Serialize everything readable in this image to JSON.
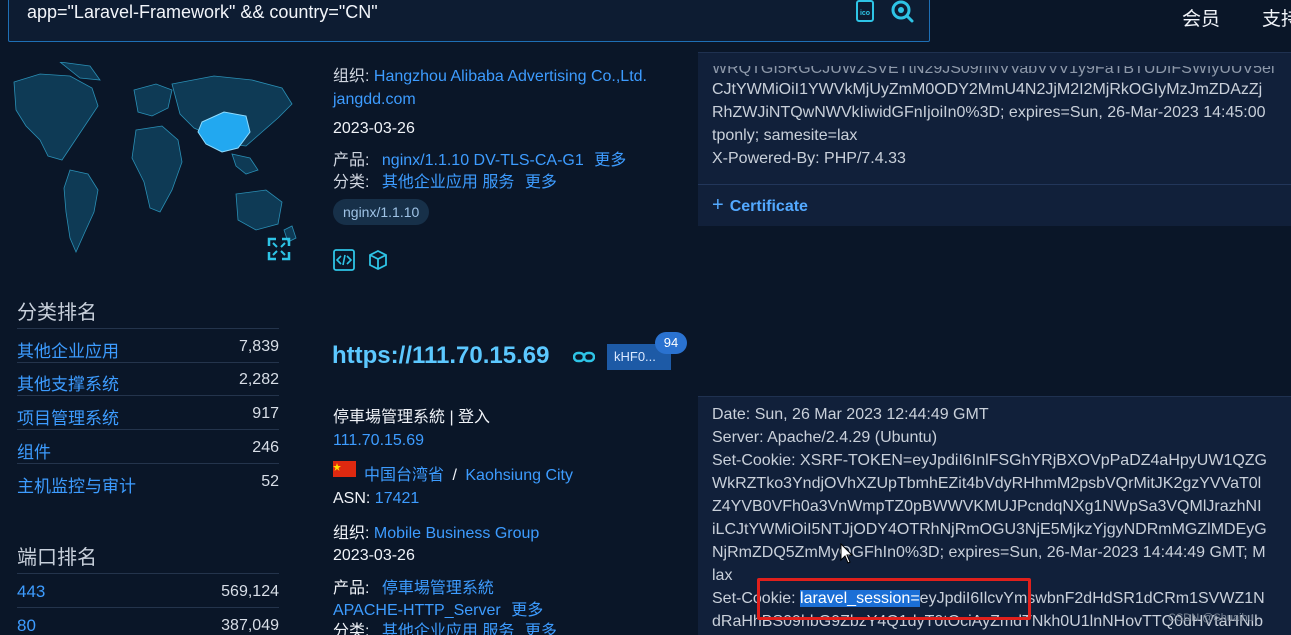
{
  "search": {
    "query": "app=\"Laravel-Framework\" && country=\"CN\""
  },
  "topnav": {
    "member": "会员",
    "support": "支持"
  },
  "sidebar": {
    "category_title": "分类排名",
    "categories": [
      {
        "name": "其他企业应用",
        "count": "7,839"
      },
      {
        "name": "其他支撑系统",
        "count": "2,282"
      },
      {
        "name": "项目管理系统",
        "count": "917"
      },
      {
        "name": "组件",
        "count": "246"
      },
      {
        "name": "主机监控与审计",
        "count": "52"
      }
    ],
    "port_title": "端口排名",
    "ports": [
      {
        "port": "443",
        "count": "569,124"
      },
      {
        "port": "80",
        "count": "387,049"
      }
    ]
  },
  "result1": {
    "org_label": "组织:",
    "org": "Hangzhou Alibaba Advertising Co.,Ltd.",
    "domain": "jangdd.com",
    "date": "2023-03-26",
    "product_label": "产品:",
    "product": "nginx/1.1.10 DV-TLS-CA-G1",
    "more1": "更多",
    "category_label": "分类:",
    "category": "其他企业应用 服务",
    "more2": "更多",
    "tag": "nginx/1.1.10",
    "response": [
      "WRQTGI5RGCJUWZSVETtN29JS09hNVVabVVV1y9FaTBTUDIFSWIyUUV5ei",
      "CJtYWMiOiI1YWVkMjUyZmM0ODY2MmU4N2JjM2I2MjRkOGIyMzJmZDAzZj",
      "RhZWJiNTQwNWVkIiwidGFnIjoiIn0%3D; expires=Sun, 26-Mar-2023 14:45:00",
      "tponly; samesite=lax",
      "X-Powered-By: PHP/7.4.33"
    ],
    "certificate": "Certificate"
  },
  "result2": {
    "host": "https://111.70.15.69",
    "badge": "kHF0...",
    "badge_count": "94",
    "title": "停車場管理系統 | 登入",
    "ip": "111.70.15.69",
    "region": "中国台湾省",
    "separator": "/",
    "city": "Kaohsiung City",
    "asn_label": "ASN:",
    "asn": "17421",
    "org_label": "组织:",
    "org": "Mobile Business Group",
    "date": "2023-03-26",
    "product_label": "产品:",
    "product": "停車場管理系統",
    "product2": "APACHE-HTTP_Server",
    "more1": "更多",
    "category_label": "分类:",
    "category": "其他企业应用 服务",
    "more2": "更多",
    "response": [
      "Date: Sun, 26 Mar 2023 12:44:49 GMT",
      "Server: Apache/2.4.29 (Ubuntu)",
      "Set-Cookie: XSRF-TOKEN=eyJpdiI6InlFSGhYRjBXOVpPaDZ4aHpyUW1QZG",
      "WkRZTko3YndjOVhXZUpTbmhEZit4bVdyRHhmM2psbVQrMitJK2gzYVVaT0l",
      "Z4YVB0VFh0a3VnWmpTZ0pBWWVKMUJPcndqNXg1NWpSa3VQMlJrazhNI",
      "iLCJtYWMiOiI5NTJjODY4OTRhNjRmOGU3NjE5MjkzYjgyNDRmMGZlMDEyG",
      "NjRmZDQ5ZmMyOGFhIn0%3D; expires=Sun, 26-Mar-2023 14:44:49 GMT; M",
      "lax"
    ],
    "cookie_prefix": "Set-Cookie: ",
    "cookie_key": "laravel_session=",
    "cookie_rest": "eyJpdiI6IlcvYmswbnF2dHdSR1dCRm1SVWZ1N",
    "response_last": "dRaHhBS09hbG9ZbzY4Q1dyT0tOciAyZmdTNkh0U1lnNHovTTQ0dHVtaHNlb"
  },
  "watermark": "CSDN @Shuaihu"
}
